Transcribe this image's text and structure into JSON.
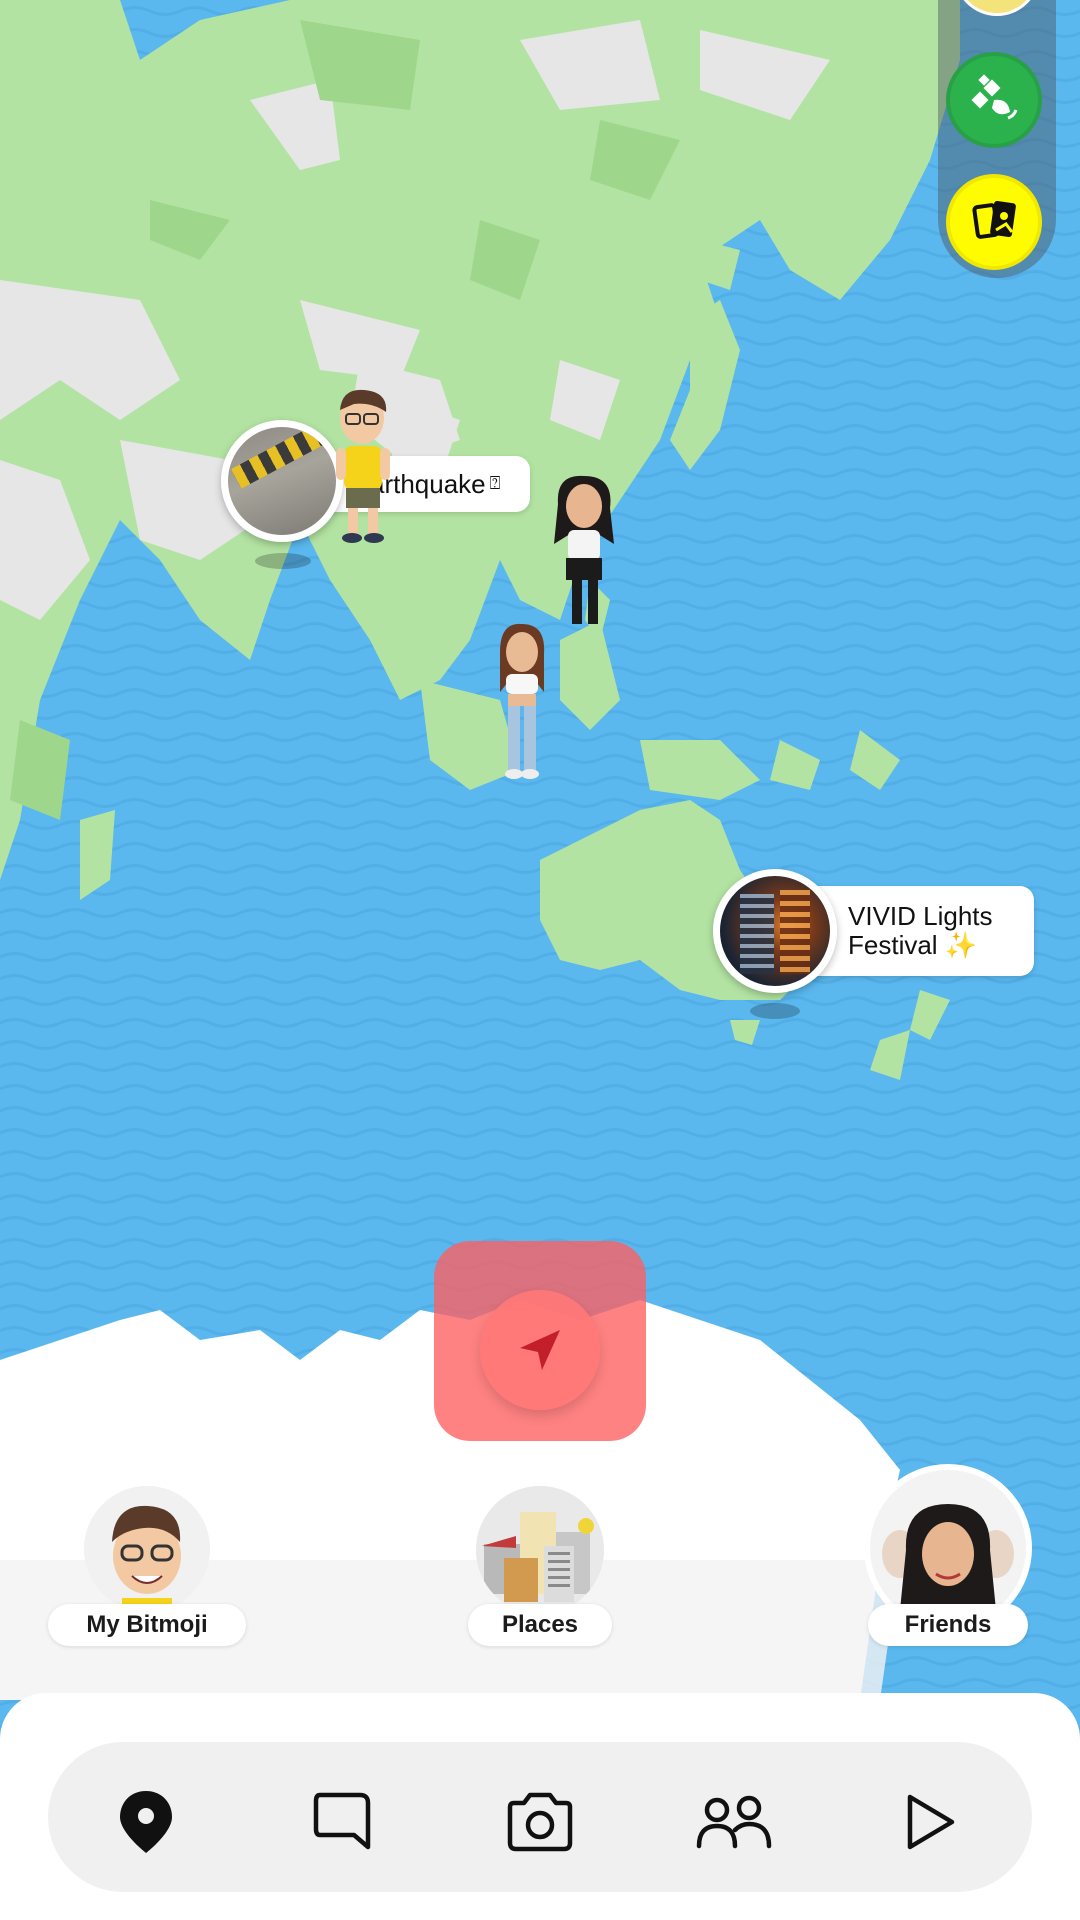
{
  "colors": {
    "ocean": "#5ab8ef",
    "land": "#b3e3a2",
    "land_dark": "#9ed78b",
    "snow": "#e9e9e9",
    "accent_yellow": "#fffc00",
    "accent_green": "#2bb24c",
    "highlight_red": "#ff5f5f",
    "nav_bg": "#f0f0f0"
  },
  "map_events": [
    {
      "label": "arthquake",
      "trailing_glyph": "⍰",
      "icon": "earthquake-thumbnail"
    },
    {
      "label_line1": "VIVID Lights",
      "label_line2": "Festival",
      "emoji": "✨",
      "icon": "festival-thumbnail"
    }
  ],
  "rail_buttons": [
    {
      "name": "satellite-icon",
      "color": "#2bb24c"
    },
    {
      "name": "memories-cards-icon",
      "color": "#fffc00"
    }
  ],
  "locate_button": {
    "icon": "navigation-arrow-icon"
  },
  "shortcuts": {
    "my_bitmoji": "My Bitmoji",
    "places": "Places",
    "friends": "Friends"
  },
  "bottom_nav": [
    {
      "icon": "map-pin-icon",
      "active": true
    },
    {
      "icon": "chat-icon",
      "active": false
    },
    {
      "icon": "camera-icon",
      "active": false
    },
    {
      "icon": "friends-icon",
      "active": false
    },
    {
      "icon": "play-icon",
      "active": false
    }
  ]
}
